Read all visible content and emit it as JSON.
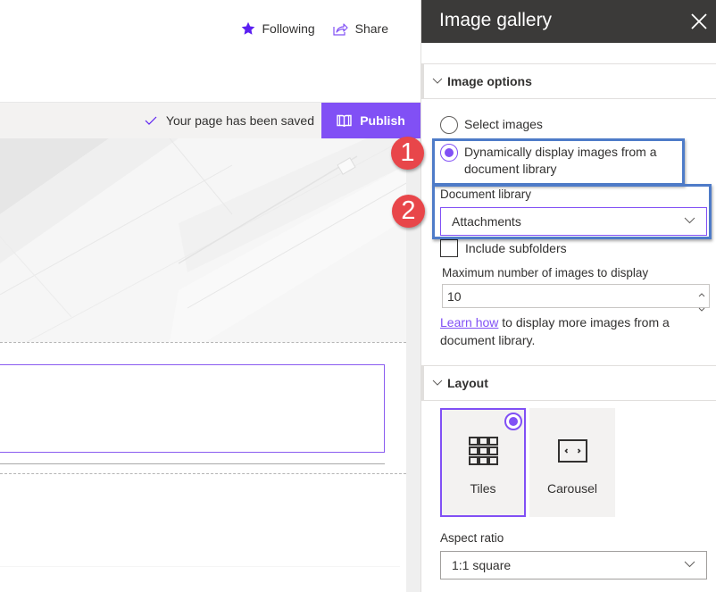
{
  "page": {
    "actions": [
      {
        "label": "Following",
        "icon": "star-icon"
      },
      {
        "label": "Share",
        "icon": "share-icon"
      }
    ],
    "status": {
      "text": "Your page has been saved",
      "icon": "checkmark-icon"
    },
    "publish": {
      "label": "Publish",
      "icon": "book-icon"
    }
  },
  "panel": {
    "title": "Image gallery",
    "close_icon": "close-icon",
    "image_options": {
      "header": "Image options",
      "radios": [
        {
          "label": "Select images",
          "selected": false
        },
        {
          "label": "Dynamically display images from a document library",
          "selected": true
        }
      ],
      "document_library": {
        "label": "Document library",
        "value": "Attachments"
      },
      "include_subfolders": {
        "label": "Include subfolders",
        "checked": false
      },
      "max_images": {
        "label": "Maximum number of images to display",
        "value": "10"
      },
      "help": {
        "link": "Learn how",
        "rest": " to display more images from a document library."
      }
    },
    "layout": {
      "header": "Layout",
      "options": [
        {
          "label": "Tiles",
          "icon": "tiles-grid-icon",
          "selected": true
        },
        {
          "label": "Carousel",
          "icon": "carousel-icon",
          "selected": false
        }
      ],
      "aspect_ratio": {
        "label": "Aspect ratio",
        "value": "1:1 square"
      }
    }
  },
  "annotations": [
    {
      "number": "1",
      "target": "Dynamically display images option"
    },
    {
      "number": "2",
      "target": "Document library dropdown"
    }
  ],
  "colors": {
    "accent": "#8150f5",
    "panel_header": "#3b3a39",
    "callout_border": "#4e7bc8",
    "badge": "#e8464a"
  }
}
